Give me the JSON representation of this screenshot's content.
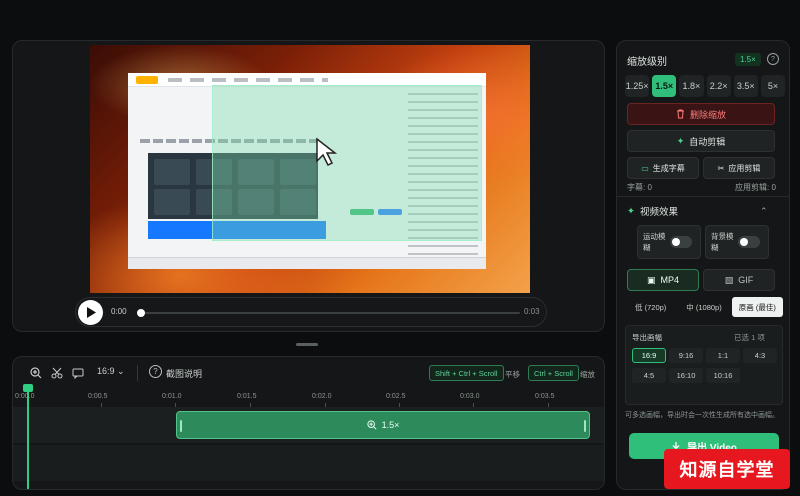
{
  "player": {
    "time_current": "0:00",
    "time_end": "0:03",
    "progress": 0
  },
  "timeline": {
    "aspect_label": "16:9",
    "help_label": "截图说明",
    "shortcut_pan": "Shift + Ctrl + Scroll",
    "shortcut_pan_label": "平移",
    "shortcut_zoom": "Ctrl + Scroll",
    "shortcut_zoom_label": "缩放",
    "ruler_ticks": [
      "0:00.0",
      "0:00.5",
      "0:01.0",
      "0:01.5",
      "0:02.0",
      "0:02.5",
      "0:03.0",
      "0:03.5"
    ],
    "clip_label": "1.5×"
  },
  "settings": {
    "zoom_title": "缩放级别",
    "zoom_value": "1.5×",
    "zoom_levels": [
      "1.25×",
      "1.5×",
      "1.8×",
      "2.2×",
      "3.5×",
      "5×"
    ],
    "delete_zoom_label": "删除缩放",
    "auto_edit_label": "自动剪辑",
    "gen_subtitle_label": "生成字幕",
    "apply_clip_label": "应用剪辑",
    "subtitle_count": "字幕: 0",
    "clip_count": "应用剪辑: 0",
    "effects_title": "视频效果",
    "motion_blur_label": "运动模糊",
    "bg_blur_label": "背景模糊",
    "format_mp4": "MP4",
    "format_gif": "GIF",
    "quality_low": "低 (720p)",
    "quality_mid": "中 (1080p)",
    "quality_high": "原画 (最佳)",
    "ratio_title": "导出画幅",
    "ratio_selected": "已选 1 项",
    "ratios": [
      "16:9",
      "9:16",
      "1:1",
      "4:3",
      "4:5",
      "16:10",
      "10:16"
    ],
    "ratio_note": "可多选画幅，导出时会一次性生成所有选中画幅。",
    "export_label": "导出 Video"
  },
  "watermark": "知源自学堂"
}
